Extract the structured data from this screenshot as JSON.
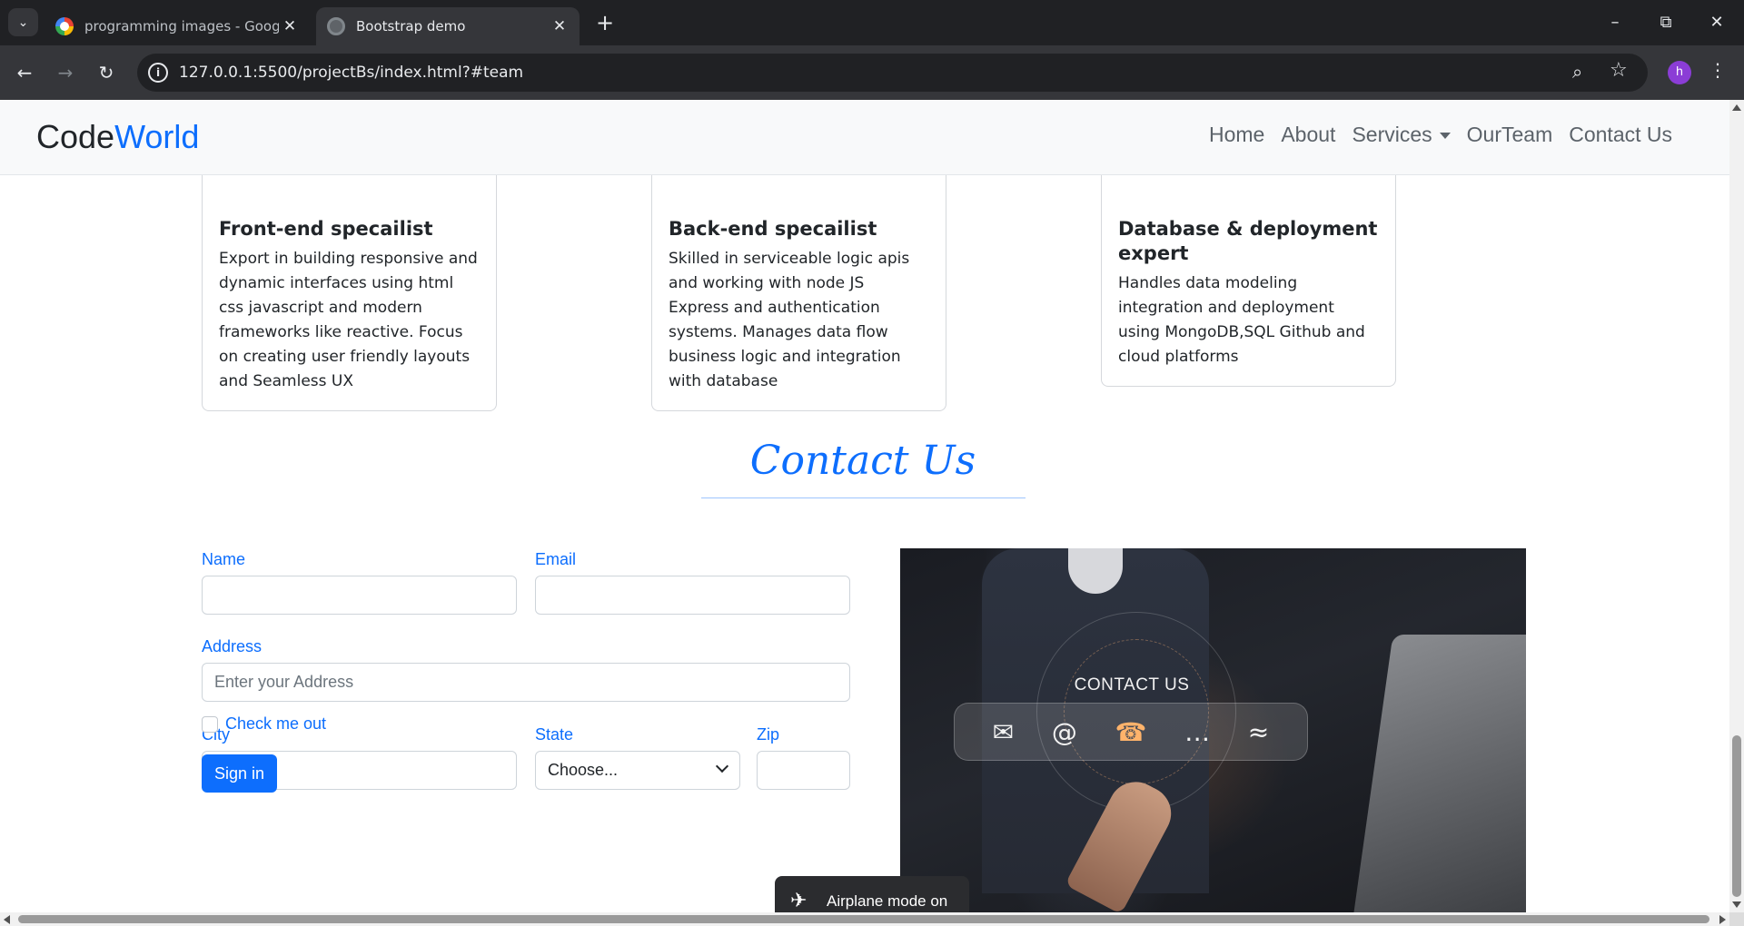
{
  "browser": {
    "tabs": [
      {
        "title": "programming images - Google",
        "active": false
      },
      {
        "title": "Bootstrap demo",
        "active": true
      }
    ],
    "url": "127.0.0.1:5500/projectBs/index.html?#team",
    "profile_initial": "h",
    "icons": {
      "tab_menu": "chevron-down-icon",
      "new_tab": "plus-icon",
      "back": "arrow-left-icon",
      "forward": "arrow-right-icon",
      "reload": "reload-icon",
      "site_info": "info-icon",
      "zoom": "zoom-out-icon",
      "bookmark": "star-icon",
      "menu": "kebab-icon"
    }
  },
  "navbar": {
    "brand_main": "Code",
    "brand_accent": "World",
    "links": [
      "Home",
      "About",
      "Services",
      "OurTeam",
      "Contact Us"
    ]
  },
  "team": [
    {
      "title": "Front-end specailist",
      "text": "Export in building responsive and dynamic interfaces using html css javascript and modern frameworks like reactive. Focus on creating user friendly layouts and Seamless UX"
    },
    {
      "title": "Back-end specailist",
      "text": "Skilled in serviceable logic apis and working with node JS Express and authentication systems. Manages data flow business logic and integration with database"
    },
    {
      "title": "Database & deployment expert",
      "text": "Handles data modeling integration and deployment using MongoDB,SQL Github and cloud platforms"
    }
  ],
  "contact": {
    "title": "Contact Us",
    "form": {
      "name_label": "Name",
      "email_label": "Email",
      "address_label": "Address",
      "address_placeholder": "Enter your Address",
      "city_label": "City",
      "state_label": "State",
      "state_value": "Choose...",
      "zip_label": "Zip",
      "checkbox_label": "Check me out",
      "submit_label": "Sign in"
    },
    "image_caption": "CONTACT US"
  },
  "toast": {
    "text": "Airplane mode on"
  },
  "colors": {
    "accent": "#0d6efd",
    "navbar_bg": "#f8f9fa",
    "browser_dark": "#202124"
  }
}
